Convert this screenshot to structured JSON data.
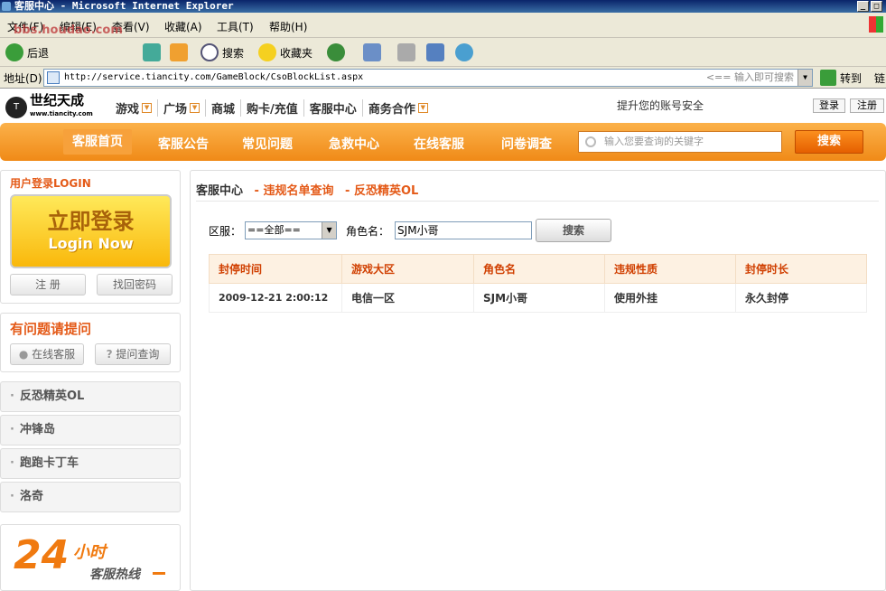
{
  "window": {
    "title": "客服中心 - Microsoft Internet Explorer"
  },
  "menubar": [
    "文件(F)",
    "编辑(E)",
    "查看(V)",
    "收藏(A)",
    "工具(T)",
    "帮助(H)"
  ],
  "toolbar": {
    "back": "后退",
    "search": "搜索",
    "favorites": "收藏夹"
  },
  "address": {
    "label": "地址(D)",
    "url": "http://service.tiancity.com/GameBlock/CsoBlockList.aspx",
    "hint": "<== 输入即可搜索",
    "go": "转到",
    "links": "链"
  },
  "watermark": "bbs.houdao.com",
  "site": {
    "logo": "世纪天成",
    "logo_sub": "www.tiancity.com",
    "security": "提升您的账号安全",
    "login": "登录",
    "register": "注册"
  },
  "topnav": [
    "游戏",
    "广场",
    "商城",
    "购卡/充值",
    "客服中心",
    "商务合作"
  ],
  "orangenav": [
    "客服首页",
    "客服公告",
    "常见问题",
    "急救中心",
    "在线客服",
    "问卷调查"
  ],
  "search": {
    "placeholder": "输入您要查询的关键字",
    "button": "搜索"
  },
  "sidebar": {
    "login_title": "用户登录LOGIN",
    "login_big": "立即登录",
    "login_now": "Login Now",
    "register": "注 册",
    "recover": "找回密码",
    "question_title": "有问题请提问",
    "online": "在线客服",
    "ask": "提问查询",
    "games": [
      "反恐精英OL",
      "冲锋岛",
      "跑跑卡丁车",
      "洛奇"
    ],
    "hotline_num": "24",
    "hotline_hour": "小时",
    "hotline_text": "客服热线"
  },
  "breadcrumb": {
    "home": "客服中心",
    "sep": "-",
    "page": "违规名单查询",
    "game": "反恐精英OL"
  },
  "form": {
    "server_label": "区服：",
    "server_value": "==全部==",
    "role_label": "角色名：",
    "role_value": "SJM小哥",
    "button": "搜索"
  },
  "table": {
    "headers": [
      "封停时间",
      "游戏大区",
      "角色名",
      "违规性质",
      "封停时长"
    ],
    "rows": [
      [
        "2009-12-21 2:00:12",
        "电信一区",
        "SJM小哥",
        "使用外挂",
        "永久封停"
      ]
    ]
  }
}
